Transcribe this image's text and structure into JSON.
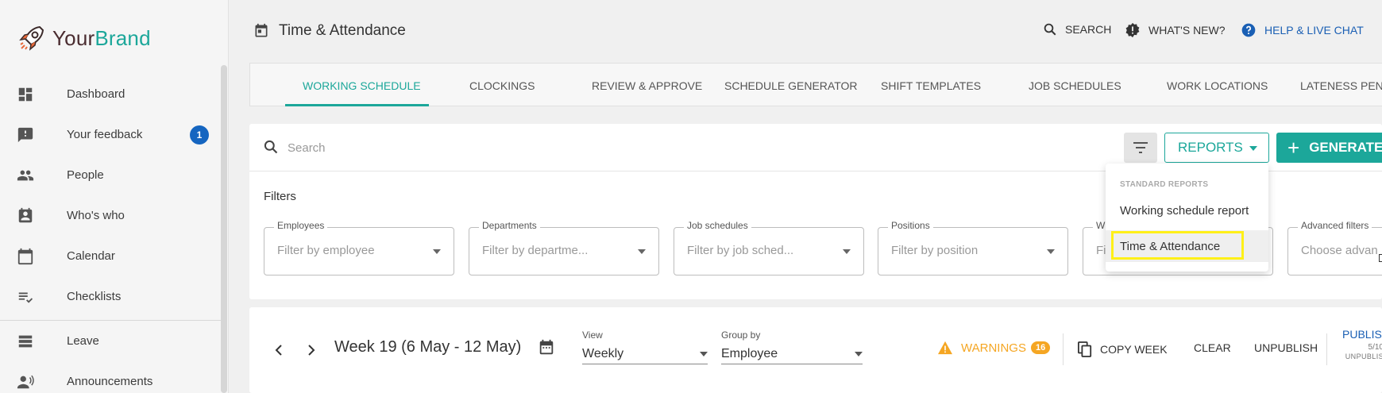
{
  "brand": {
    "part1": "Your",
    "part2": "Brand"
  },
  "sidebar": {
    "items": [
      {
        "label": "Dashboard",
        "icon": "dashboard-icon"
      },
      {
        "label": "Your feedback",
        "icon": "feedback-icon",
        "badge": "1"
      },
      {
        "label": "People",
        "icon": "people-icon"
      },
      {
        "label": "Who's who",
        "icon": "badge-icon"
      },
      {
        "label": "Calendar",
        "icon": "calendar-icon"
      },
      {
        "label": "Checklists",
        "icon": "checklist-icon"
      },
      {
        "label": "Leave",
        "icon": "leave-icon"
      },
      {
        "label": "Announcements",
        "icon": "announcement-icon"
      }
    ]
  },
  "header": {
    "title": "Time & Attendance",
    "search_label": "SEARCH",
    "whats_new_label": "WHAT'S NEW?",
    "help_label": "HELP & LIVE CHAT"
  },
  "tabs": [
    "WORKING SCHEDULE",
    "CLOCKINGS",
    "REVIEW & APPROVE",
    "SCHEDULE GENERATOR",
    "SHIFT TEMPLATES",
    "JOB SCHEDULES",
    "WORK LOCATIONS",
    "LATENESS PEN"
  ],
  "toolbar": {
    "search_placeholder": "Search",
    "reports_label": "REPORTS",
    "generate_label": "GENERATE"
  },
  "filters": {
    "title": "Filters",
    "fields": [
      {
        "label": "Employees",
        "placeholder": "Filter by employee"
      },
      {
        "label": "Departments",
        "placeholder": "Filter by departme..."
      },
      {
        "label": "Job schedules",
        "placeholder": "Filter by job sched..."
      },
      {
        "label": "Positions",
        "placeholder": "Filter by position"
      },
      {
        "label": "W",
        "placeholder": "Fi"
      },
      {
        "label": "Advanced filters",
        "placeholder": "Choose advan"
      }
    ]
  },
  "reports_menu": {
    "section": "STANDARD REPORTS",
    "items": [
      "Working schedule report",
      "Time & Attendance"
    ]
  },
  "schedule": {
    "week_title": "Week 19 (6 May - 12 May)",
    "view_label": "View",
    "view_value": "Weekly",
    "group_label": "Group by",
    "group_value": "Employee",
    "warnings_label": "WARNINGS",
    "warnings_count": "16",
    "copy_week": "COPY WEEK",
    "clear": "CLEAR",
    "unpublish": "UNPUBLISH",
    "publish": "PUBLISH",
    "publish_count": "5/10",
    "unpublished_label": "UNPUBLIS"
  },
  "colors": {
    "accent": "#1ca79a",
    "link": "#1a5fb4",
    "warning": "#f5a623",
    "highlight": "#fff018",
    "badge": "#1565c0"
  }
}
